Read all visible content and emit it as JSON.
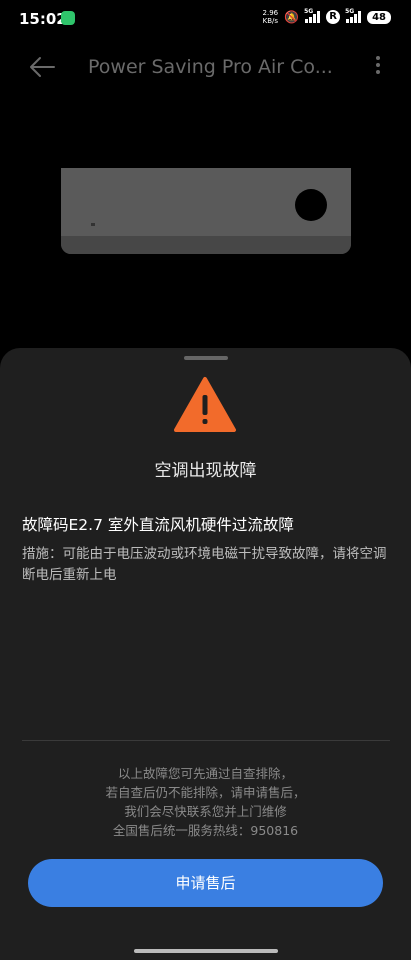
{
  "status": {
    "time": "15:02",
    "net_speed_top": "2.96",
    "net_speed_bottom": "KB/s",
    "network1": "5G",
    "network2": "5G",
    "roaming_badge": "R",
    "battery": "48"
  },
  "header": {
    "title": "Power Saving Pro Air Co..."
  },
  "sheet": {
    "title": "空调出现故障",
    "fault_code": "故障码E2.7 室外直流风机硬件过流故障",
    "measure": "措施：可能由于电压波动或环境电磁干扰导致故障，请将空调断电后重新上电",
    "notes": [
      "以上故障您可先通过自查排除，",
      "若自查后仍不能排除，请申请售后，",
      "我们会尽快联系您并上门维修",
      "全国售后统一服务热线：950816"
    ],
    "button_label": "申请售后"
  },
  "colors": {
    "accent": "#3a7fe2",
    "warning": "#f26b2b"
  }
}
